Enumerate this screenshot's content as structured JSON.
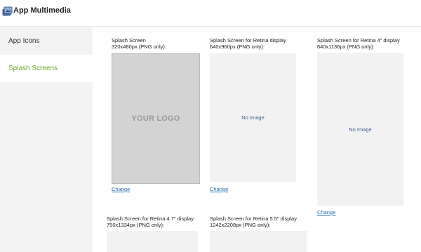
{
  "app": {
    "title": "App Multimedia",
    "icon": "multimedia-icon"
  },
  "sidebar": {
    "items": [
      {
        "label": "App Icons",
        "selected": false
      },
      {
        "label": "Splash Screens",
        "selected": true
      }
    ],
    "accent_color": "#71a62b"
  },
  "splash_screens": [
    {
      "title_line1": "Splash Screen",
      "title_line2": "320x480px (PNG only):",
      "preview": "YOUR LOGO",
      "change_label": "Change"
    },
    {
      "title_line1": "Splash Screen for Retina display",
      "title_line2": "640x960px (PNG only):",
      "preview": "No Image",
      "change_label": "Change"
    },
    {
      "title_line1": "Splash Screen for Retina 4\" display",
      "title_line2": "640x1136px (PNG only):",
      "preview": "No Image",
      "change_label": "Change"
    },
    {
      "title_line1": "Splash Screen for Retina 4.7\" display",
      "title_line2": "750x1334px (PNG only):",
      "preview": "",
      "change_label": ""
    },
    {
      "title_line1": "Splash Screen for Retina 5.5\" display",
      "title_line2": "1242x2208px (PNG only):",
      "preview": "",
      "change_label": ""
    }
  ]
}
